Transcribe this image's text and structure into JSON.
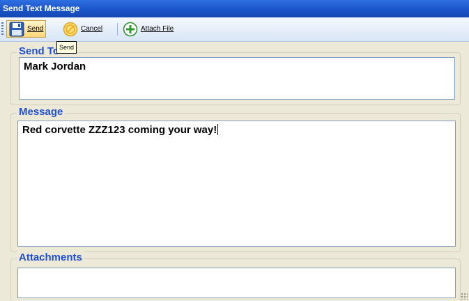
{
  "window": {
    "title": "Send Text Message"
  },
  "toolbar": {
    "send_label": "Send",
    "cancel_label": "Cancel",
    "attach_label": "Attach File",
    "send_icon": "floppy-disk-icon",
    "cancel_icon": "cancel-icon",
    "attach_icon": "add-icon"
  },
  "tooltip": {
    "text": "Send"
  },
  "send_to": {
    "label": "Send To",
    "value": "Mark Jordan"
  },
  "message": {
    "label": "Message",
    "value": "Red corvette ZZZ123 coming your way!"
  },
  "attachments": {
    "label": "Attachments",
    "value": ""
  },
  "colors": {
    "title_bar": "#1a54c8",
    "group_label": "#1f4fd0",
    "window_bg": "#ece9d8"
  }
}
